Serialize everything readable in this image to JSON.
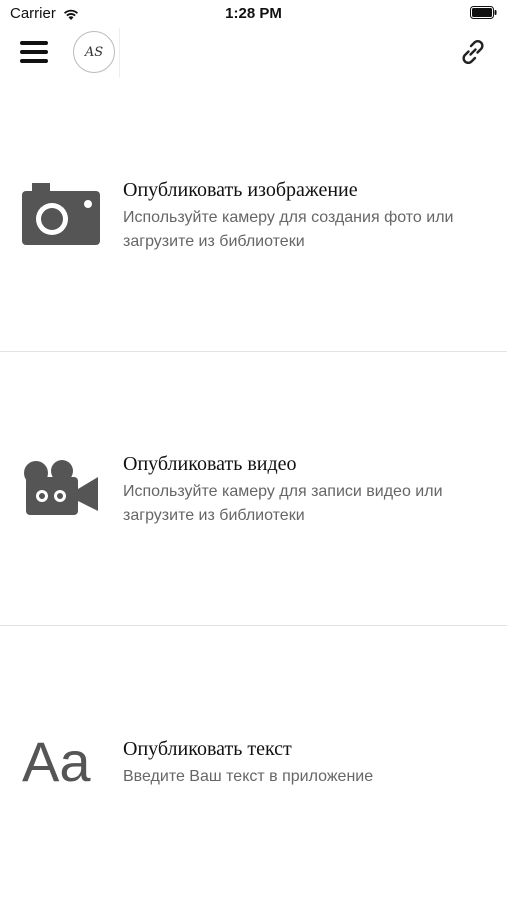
{
  "status_bar": {
    "carrier": "Carrier",
    "time": "1:28 PM"
  },
  "nav": {
    "logo_text": "AS"
  },
  "sections": [
    {
      "icon": "camera-icon",
      "title": "Опубликовать изображение",
      "description": "Используйте камеру для создания фото или загрузите из библиотеки"
    },
    {
      "icon": "video-camera-icon",
      "title": "Опубликовать видео",
      "description": "Используйте камеру для записи видео или загрузите из библиотеки"
    },
    {
      "icon": "text-icon",
      "icon_text": "Aa",
      "title": "Опубликовать текст",
      "description": "Введите Ваш текст в приложение"
    }
  ],
  "colors": {
    "icon": "#555555",
    "description": "#666666",
    "divider": "#e2e2e2"
  }
}
